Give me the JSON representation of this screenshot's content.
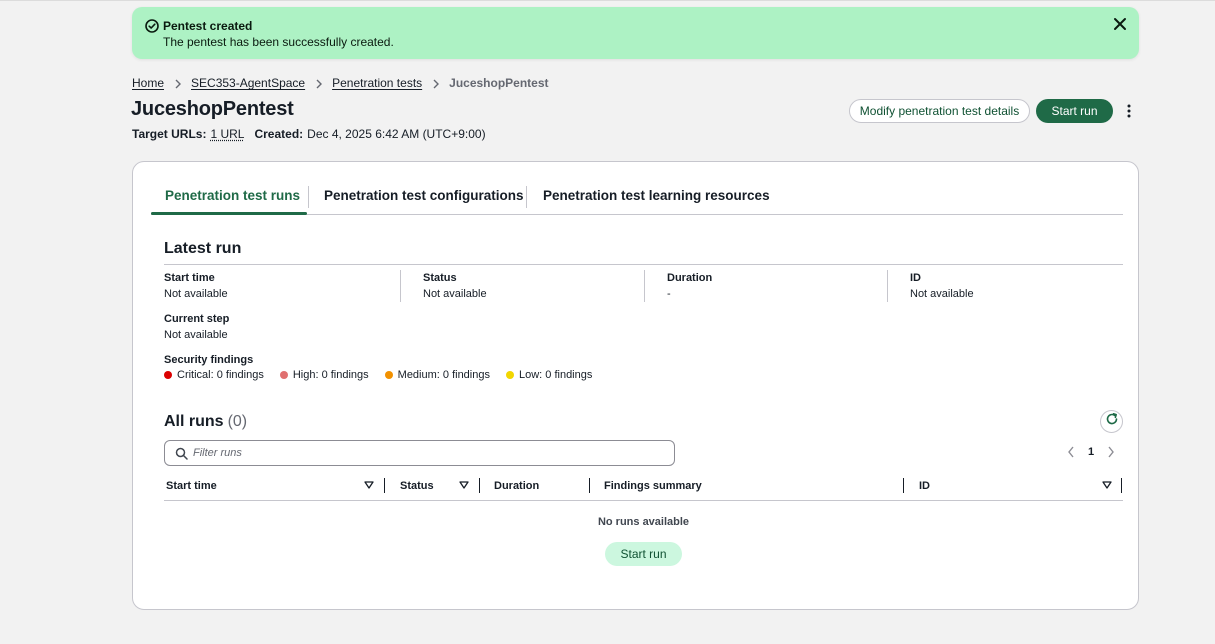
{
  "flash": {
    "title": "Pentest created",
    "message": "The pentest has been successfully created.",
    "icon": "check-circle-icon",
    "color": "#adf2c4"
  },
  "breadcrumb": {
    "items": [
      "Home",
      "SEC353-AgentSpace",
      "Penetration tests"
    ],
    "current": "JuceshopPentest"
  },
  "header": {
    "title": "JuceshopPentest",
    "target_urls_label": "Target URLs:",
    "target_urls_value": "1 URL",
    "created_label": "Created:",
    "created_value": "Dec 4, 2025 6:42 AM (UTC+9:00)",
    "modify_button": "Modify penetration test details",
    "start_button": "Start run"
  },
  "tabs": [
    {
      "label": "Penetration test runs",
      "active": true
    },
    {
      "label": "Penetration test configurations",
      "active": false
    },
    {
      "label": "Penetration test learning resources",
      "active": false
    }
  ],
  "latest_run": {
    "title": "Latest run",
    "start_time_label": "Start time",
    "start_time_value": "Not available",
    "status_label": "Status",
    "status_value": "Not available",
    "duration_label": "Duration",
    "duration_value": "-",
    "id_label": "ID",
    "id_value": "Not available",
    "current_step_label": "Current step",
    "current_step_value": "Not available",
    "findings_label": "Security findings",
    "findings": [
      {
        "text": "Critical: 0 findings",
        "color": "#db0000"
      },
      {
        "text": "High: 0 findings",
        "color": "#e07070"
      },
      {
        "text": "Medium: 0 findings",
        "color": "#f29100"
      },
      {
        "text": "Low: 0 findings",
        "color": "#f2d600"
      }
    ]
  },
  "all_runs": {
    "title": "All runs",
    "count": "(0)",
    "filter_placeholder": "Filter runs",
    "page": "1",
    "columns": [
      "Start time",
      "Status",
      "Duration",
      "Findings summary",
      "ID"
    ],
    "empty_text": "No runs available",
    "empty_button": "Start run"
  },
  "colors": {
    "primary": "#1f6a47",
    "background": "#f2f2f2"
  }
}
